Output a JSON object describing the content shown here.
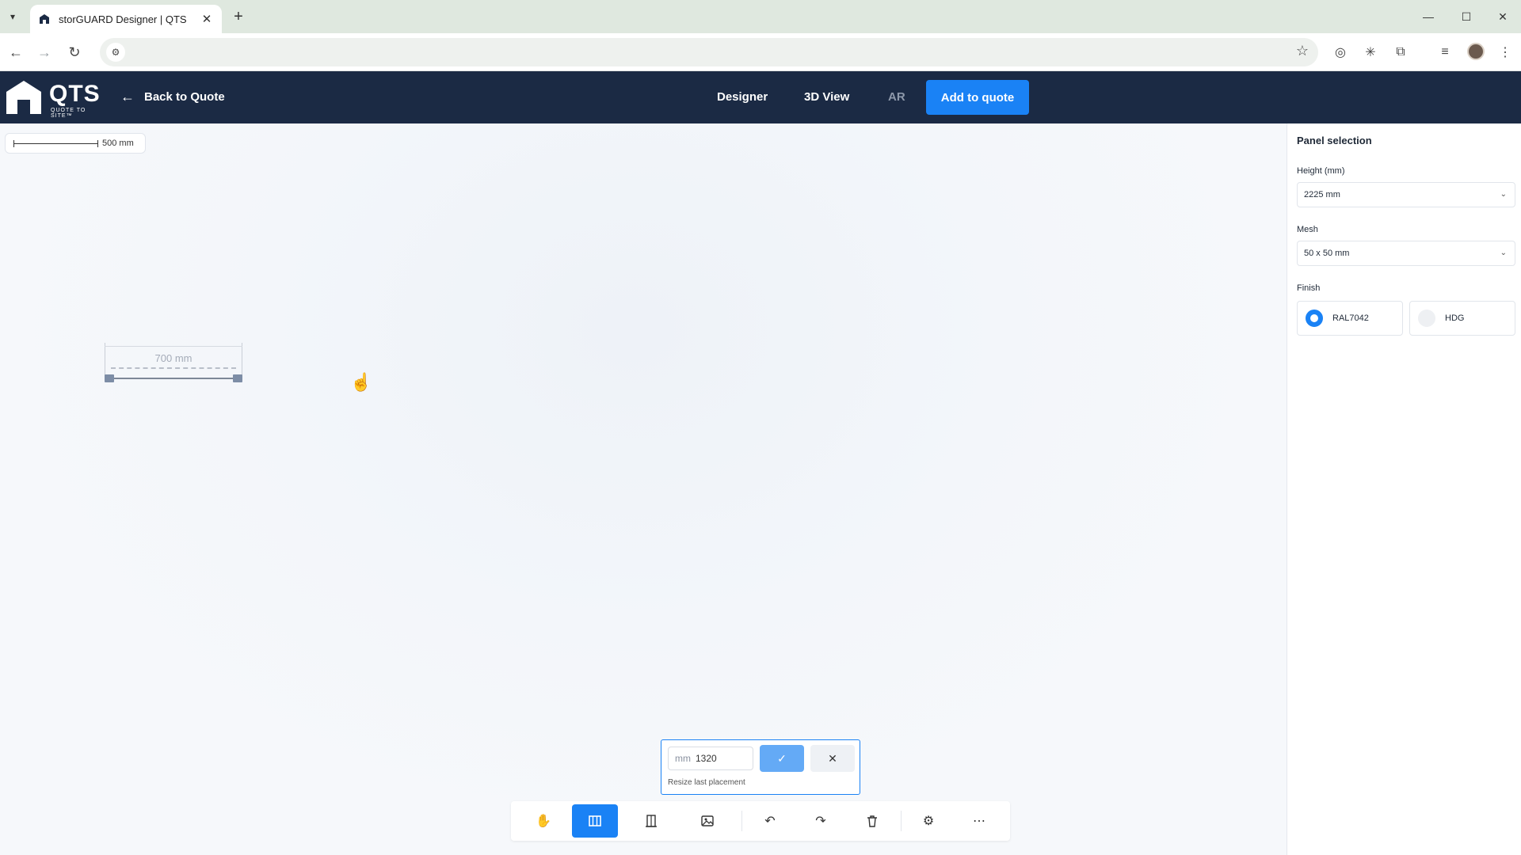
{
  "browser": {
    "tab_title": "storGUARD Designer | QTS",
    "new_tab": "+",
    "minimize": "—",
    "maximize": "☐",
    "close": "✕"
  },
  "header": {
    "logo_text": "QTS",
    "logo_subtext": "QUOTE TO SITE™",
    "back_label": "Back to Quote",
    "tabs": [
      {
        "label": "Designer",
        "active": true
      },
      {
        "label": "3D View",
        "active": false
      },
      {
        "label": "AR",
        "active": false
      }
    ],
    "add_to_quote_label": "Add to quote",
    "accent_color": "#1a82f5",
    "header_color": "#1b2a44"
  },
  "canvas": {
    "scale_label": "500 mm",
    "panel_dimension": "700 mm"
  },
  "resize_dialog": {
    "unit": "mm",
    "value": "1320",
    "hint": "Resize last placement",
    "confirm_icon": "check-icon",
    "cancel_icon": "close-icon"
  },
  "toolbar": {
    "tools": [
      {
        "name": "pan-tool",
        "icon": "hand-icon",
        "active": false
      },
      {
        "name": "fence-tool",
        "icon": "fence-panel-icon",
        "active": true
      },
      {
        "name": "door-tool",
        "icon": "door-icon",
        "active": false
      },
      {
        "name": "image-tool",
        "icon": "image-icon",
        "active": false
      },
      {
        "name": "undo",
        "icon": "undo-icon",
        "active": false
      },
      {
        "name": "redo",
        "icon": "redo-icon",
        "active": false
      },
      {
        "name": "delete",
        "icon": "trash-icon",
        "active": false
      },
      {
        "name": "settings",
        "icon": "gear-icon",
        "active": false
      },
      {
        "name": "more",
        "icon": "more-icon",
        "active": false
      }
    ]
  },
  "sidebar": {
    "title": "Panel selection",
    "height_label": "Height (mm)",
    "height_value": "2225 mm",
    "mesh_label": "Mesh",
    "mesh_value": "50 x 50 mm",
    "finish_label": "Finish",
    "finish_options": [
      {
        "label": "RAL7042",
        "selected": true
      },
      {
        "label": "HDG",
        "selected": false
      }
    ]
  }
}
